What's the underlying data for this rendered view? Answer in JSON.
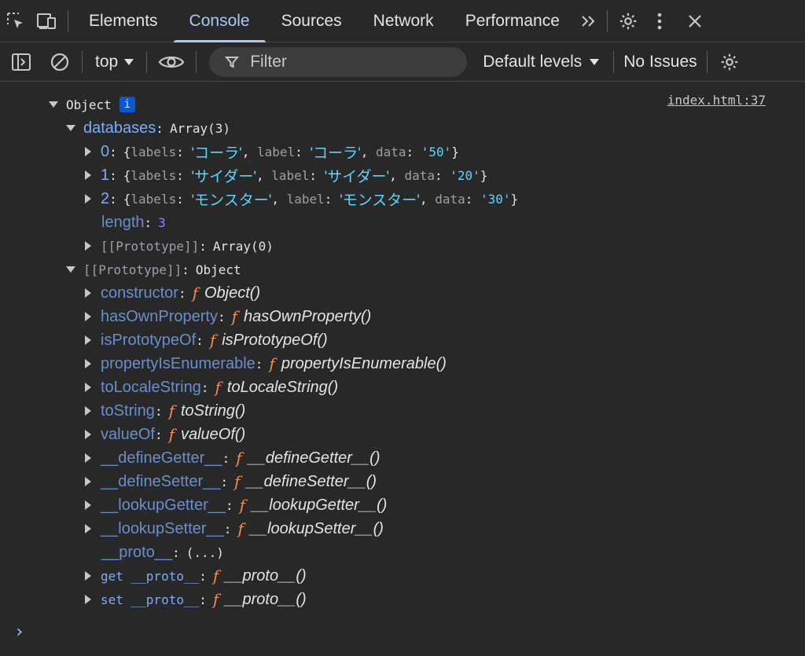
{
  "tabbar": {
    "tabs": [
      {
        "label": "Elements",
        "active": false
      },
      {
        "label": "Console",
        "active": true
      },
      {
        "label": "Sources",
        "active": false
      },
      {
        "label": "Network",
        "active": false
      },
      {
        "label": "Performance",
        "active": false
      }
    ],
    "more_icon": "double-chevron-right-icon"
  },
  "toolbar": {
    "context": "top",
    "filter_placeholder": "Filter",
    "levels": "Default levels",
    "issues": "No Issues"
  },
  "console": {
    "source_link": "index.html:37",
    "root_label": "Object",
    "info_badge": "i",
    "databases_key": "databases",
    "databases_value": "Array(3)",
    "items": [
      {
        "index": "0",
        "labels": "'コーラ'",
        "label": "'コーラ'",
        "data": "'50'"
      },
      {
        "index": "1",
        "labels": "'サイダー'",
        "label": "'サイダー'",
        "data": "'20'"
      },
      {
        "index": "2",
        "labels": "'モンスター'",
        "label": "'モンスター'",
        "data": "'30'"
      }
    ],
    "labels_key": "labels",
    "label_key": "label",
    "data_key": "data",
    "length_key": "length",
    "length_value": "3",
    "array_proto_key": "[[Prototype]]",
    "array_proto_value": "Array(0)",
    "obj_proto_key": "[[Prototype]]",
    "obj_proto_value": "Object",
    "methods": [
      {
        "key": "constructor",
        "fn": "Object()"
      },
      {
        "key": "hasOwnProperty",
        "fn": "hasOwnProperty()"
      },
      {
        "key": "isPrototypeOf",
        "fn": "isPrototypeOf()"
      },
      {
        "key": "propertyIsEnumerable",
        "fn": "propertyIsEnumerable()"
      },
      {
        "key": "toLocaleString",
        "fn": "toLocaleString()"
      },
      {
        "key": "toString",
        "fn": "toString()"
      },
      {
        "key": "valueOf",
        "fn": "valueOf()"
      },
      {
        "key": "__defineGetter__",
        "fn": "__defineGetter__()"
      },
      {
        "key": "__defineSetter__",
        "fn": "__defineSetter__()"
      },
      {
        "key": "__lookupGetter__",
        "fn": "__lookupGetter__()"
      },
      {
        "key": "__lookupSetter__",
        "fn": "__lookupSetter__()"
      }
    ],
    "proto_key": "__proto__",
    "proto_value": "(...)",
    "get_proto_key": "get __proto__",
    "get_proto_fn": "__proto__()",
    "set_proto_key": "set __proto__",
    "set_proto_fn": "__proto__()",
    "f_glyph": "f",
    "prompt": "›"
  },
  "colors": {
    "background": "#282828",
    "accent": "#a8c7fa",
    "key": "#7cacf8",
    "string": "#5cd5fb",
    "number": "#9980ff",
    "function": "#f28b54"
  }
}
